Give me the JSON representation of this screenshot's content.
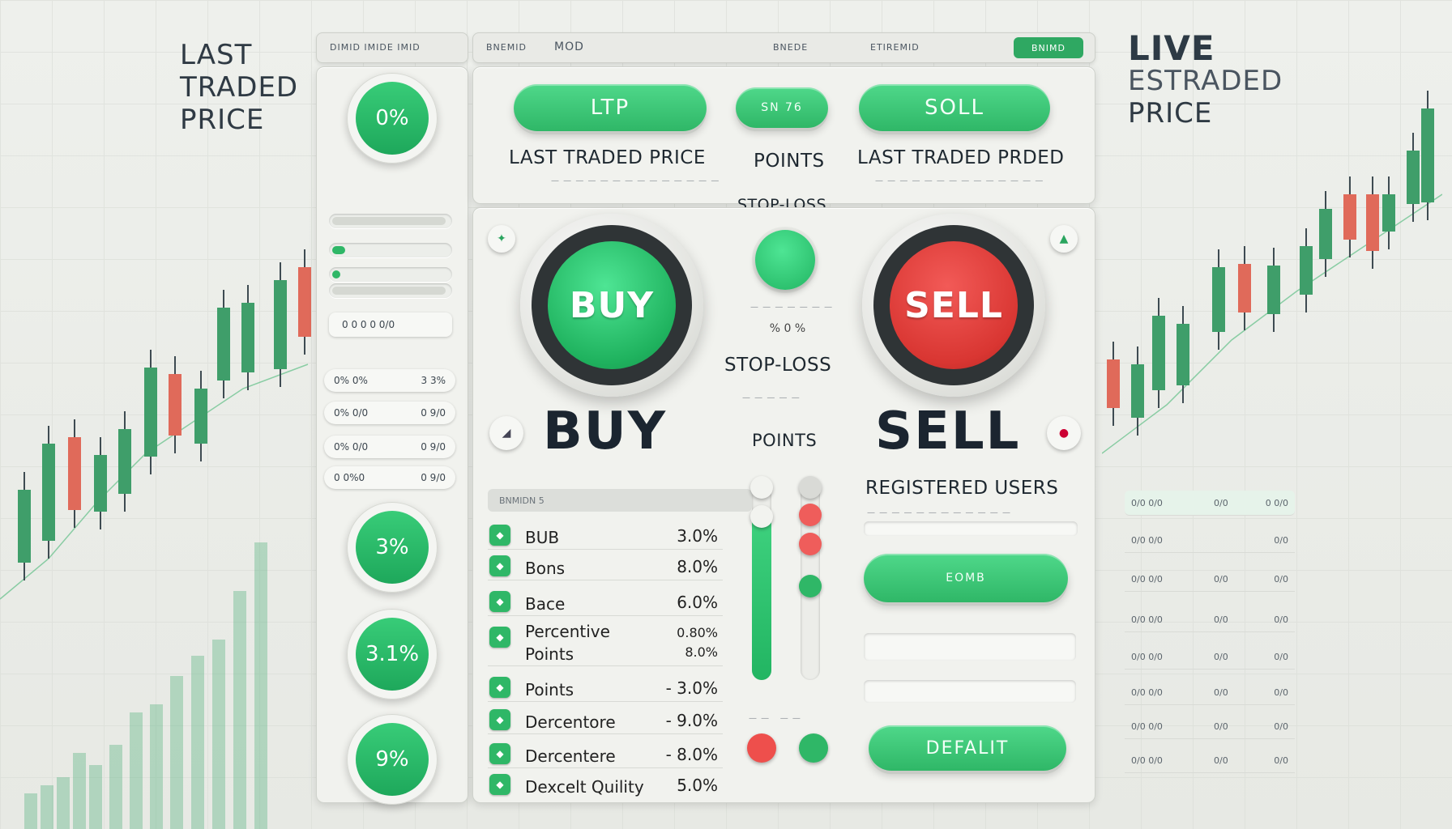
{
  "colors": {
    "green": "#2fb767",
    "red": "#e0413f",
    "dark": "#2f3436"
  },
  "left_title": "LAST\nTRADED\nPRICE",
  "right_title": {
    "line1": "LIVE",
    "line2": "ESTRADED",
    "line3": "PRICE"
  },
  "topbar": {
    "left": "DIMID IMIDE IMID",
    "mid_a": "BNEMID",
    "mid_b": "MOD",
    "mid_c": "BNEDE",
    "mid_d": "ETIREMID",
    "btn": "BNIMD"
  },
  "top": {
    "ltp_btn": "LTP",
    "ltp_label": "LAST TRADED PRICE",
    "points_btn": "SN 76",
    "points_label": "POINTS",
    "sell_btn": "SOLL",
    "sell_label": "LAST TRADED PRDED",
    "stoploss_label": "STOP-LOSS"
  },
  "circles": {
    "c1": "0%",
    "c2": "3%",
    "c3": "3.1%",
    "c4": "9%"
  },
  "sidebar_chips": [
    {
      "a": "0% 0%",
      "b": "3 3%"
    },
    {
      "a": "0% 0/0",
      "b": "0 9/0"
    },
    {
      "a": "0% 0/0",
      "b": "0 9/0"
    },
    {
      "a": "0 0%0",
      "b": "0 9/0"
    }
  ],
  "slider_chip": "0 0 0 0 0/0",
  "buy": {
    "btn": "BUY",
    "big": "BUY"
  },
  "sell": {
    "btn": "SELL",
    "big": "SELL"
  },
  "mid": {
    "stoploss": "STOP-LOSS",
    "points": "POINTS",
    "dial": "% 0 %"
  },
  "table": {
    "header": "BNMIDN 5",
    "rows": [
      {
        "name": "BUB",
        "value": "3.0%"
      },
      {
        "name": "Bons",
        "value": "8.0%"
      },
      {
        "name": "Bace",
        "value": "6.0%"
      },
      {
        "name": "Percentive\nPoints",
        "value": "0.80%\n8.0%"
      },
      {
        "name": "Points",
        "value": "- 3.0%"
      },
      {
        "name": "Dercentore",
        "value": "- 9.0%"
      },
      {
        "name": "Dercentere",
        "value": "- 8.0%"
      },
      {
        "name": "Dexcelt Quility",
        "value": "5.0%"
      }
    ]
  },
  "right_panel": {
    "registered": "REGISTERED USERS",
    "btn1": "EOMB",
    "btn2": "DEFALIT"
  },
  "right_list": [
    {
      "a": "0/0 0/0",
      "b": "0/0",
      "c": "0 0/0"
    },
    {
      "a": "0/0 0/0",
      "b": "",
      "c": "0/0"
    },
    {
      "a": "0/0 0/0",
      "b": "0/0",
      "c": "0/0"
    },
    {
      "a": "0/0 0/0",
      "b": "0/0",
      "c": "0/0"
    },
    {
      "a": "0/0 0/0",
      "b": "0/0",
      "c": "0/0"
    },
    {
      "a": "0/0 0/0",
      "b": "0/0",
      "c": "0/0"
    },
    {
      "a": "0/0 0/0",
      "b": "0/0",
      "c": "0/0"
    },
    {
      "a": "0/0 0/0",
      "b": "0/0",
      "c": "0/0"
    }
  ]
}
